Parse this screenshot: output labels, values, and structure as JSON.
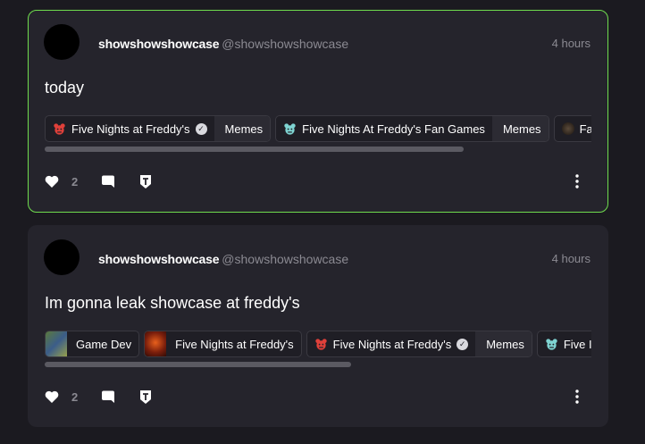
{
  "posts": [
    {
      "author": "showshowshowcase",
      "handle": "@showshowshowcase",
      "time": "4 hours",
      "text": "today",
      "tags": [
        {
          "community": "Five Nights at Freddy's",
          "verified": true,
          "sub": "Memes",
          "icon": "fnaf-red-bear-icon"
        },
        {
          "community": "Five Nights At Freddy's Fan Games",
          "sub": "Memes",
          "icon": "fnaf-teal-bear-icon"
        },
        {
          "community": "Fa",
          "icon": "community-avatar"
        }
      ],
      "likes": "2"
    },
    {
      "author": "showshowshowcase",
      "handle": "@showshowshowcase",
      "time": "4 hours",
      "text": "Im gonna leak showcase at freddy's",
      "tags": [
        {
          "community": "Game Dev",
          "icon": "gamedev-thumbnail"
        },
        {
          "community": "Five Nights at Freddy's",
          "icon": "fnaf-thumbnail"
        },
        {
          "community": "Five Nights at Freddy's",
          "verified": true,
          "sub": "Memes",
          "icon": "fnaf-red-bear-icon"
        },
        {
          "community": "Five I",
          "icon": "fnaf-teal-bear-icon"
        }
      ],
      "likes": "2"
    }
  ],
  "colors": {
    "background": "#1b1a20",
    "card": "#25242c",
    "highlight_border": "#6fdc4e",
    "muted_text": "#8b8a92",
    "fnaf_red": "#e0403a",
    "fnaf_teal": "#7fd4d2"
  }
}
